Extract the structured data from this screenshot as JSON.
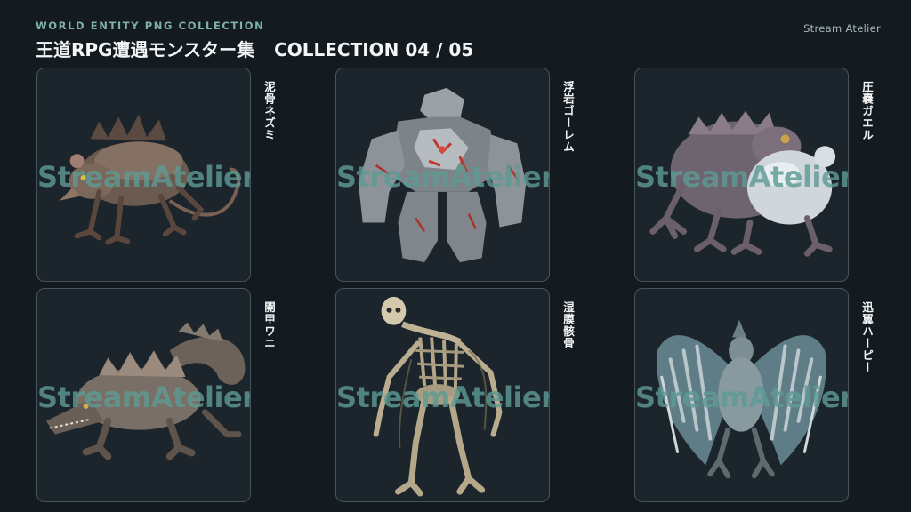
{
  "header": {
    "eyebrow": "WORLD ENTITY PNG COLLECTION",
    "title": "王道RPG遭遇モンスター集",
    "collection": "COLLECTION 04 / 05",
    "brand": "Stream Atelier"
  },
  "watermark": "StreamAtelier",
  "cards": [
    {
      "label": "泥骨ネズミ",
      "icon": "rat-monster"
    },
    {
      "label": "浮岩ゴーレム",
      "icon": "rock-golem"
    },
    {
      "label": "圧嚢ガエル",
      "icon": "sac-frog"
    },
    {
      "label": "開甲ワニ",
      "icon": "armored-crocodile"
    },
    {
      "label": "湿膜骸骨",
      "icon": "wet-skeleton"
    },
    {
      "label": "迅翼ハーピー",
      "icon": "swift-harpy"
    }
  ]
}
